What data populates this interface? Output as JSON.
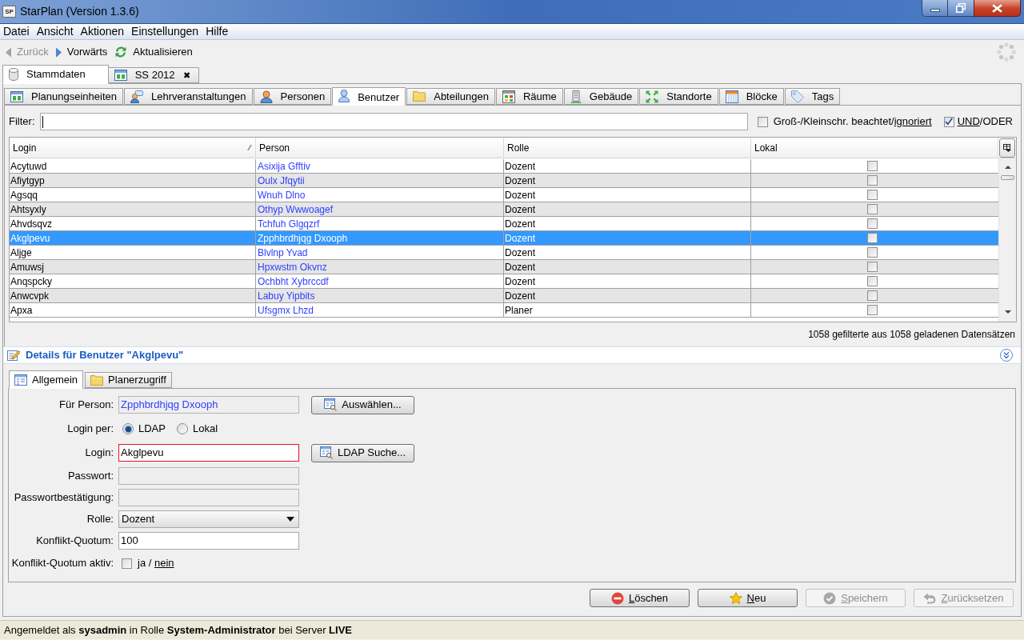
{
  "window": {
    "logo": "SP",
    "title": "StarPlan (Version 1.3.6)"
  },
  "menu": [
    "Datei",
    "Ansicht",
    "Aktionen",
    "Einstellungen",
    "Hilfe"
  ],
  "toolbar": [
    {
      "kind": "back",
      "label": "Zurück",
      "disabled": true
    },
    {
      "kind": "forward",
      "label": "Vorwärts",
      "disabled": false
    },
    {
      "kind": "refresh",
      "label": "Aktualisieren",
      "disabled": false
    }
  ],
  "main_tabs": [
    {
      "kind": "database",
      "label": "Stammdaten",
      "selected": true
    },
    {
      "kind": "table",
      "label": "SS 2012",
      "selected": false,
      "close": "✖"
    }
  ],
  "entity_tabs": [
    {
      "kind": "table",
      "label": "Planungseinheiten",
      "selected": false
    },
    {
      "kind": "lecture",
      "label": "Lehrveranstaltungen",
      "selected": false
    },
    {
      "kind": "persons",
      "label": "Personen",
      "selected": false
    },
    {
      "kind": "user",
      "label": "Benutzer",
      "selected": true
    },
    {
      "kind": "folder",
      "label": "Abteilungen",
      "selected": false
    },
    {
      "kind": "rooms",
      "label": "Räume",
      "selected": false
    },
    {
      "kind": "building",
      "label": "Gebäude",
      "selected": false
    },
    {
      "kind": "locations",
      "label": "Standorte",
      "selected": false
    },
    {
      "kind": "calendar",
      "label": "Blöcke",
      "selected": false
    },
    {
      "kind": "tag",
      "label": "Tags",
      "selected": false
    }
  ],
  "filter": {
    "label": "Filter:"
  },
  "case_option": {
    "text": "Groß-/Kleinschr. ",
    "options": [
      "beachtet",
      "ignoriert"
    ],
    "separator": "/",
    "checked": false
  },
  "logic_option": {
    "options": [
      "UND",
      "ODER"
    ],
    "separator": "/",
    "checked": true
  },
  "table": {
    "columns": [
      {
        "label": "Login",
        "sorted": true
      },
      {
        "label": "Person",
        "sorted": false
      },
      {
        "label": "Rolle",
        "sorted": false
      },
      {
        "label": "Lokal",
        "sorted": false
      }
    ],
    "rows": [
      {
        "login": "Acytuwd",
        "person": "Asixija Gfftiv",
        "role": "Dozent",
        "local": false,
        "selected": false
      },
      {
        "login": "Afiytgyp",
        "person": "Oulx Jfqytii",
        "role": "Dozent",
        "local": false,
        "selected": false
      },
      {
        "login": "Agsqq",
        "person": "Wnuh Dlno",
        "role": "Dozent",
        "local": false,
        "selected": false
      },
      {
        "login": "Ahtsyxly",
        "person": "Othyp Wwwoagef",
        "role": "Dozent",
        "local": false,
        "selected": false
      },
      {
        "login": "Ahvdsqvz",
        "person": "Tchfuh Glgqzrf",
        "role": "Dozent",
        "local": false,
        "selected": false
      },
      {
        "login": "Akglpevu",
        "person": "Zpphbrdhjqg Dxooph",
        "role": "Dozent",
        "local": false,
        "selected": true
      },
      {
        "login": "Aljge",
        "person": "Blvlnp Yvad",
        "role": "Dozent",
        "local": false,
        "selected": false
      },
      {
        "login": "Amuwsj",
        "person": "Hpxwstm Okvnz",
        "role": "Dozent",
        "local": false,
        "selected": false
      },
      {
        "login": "Anqspcky",
        "person": "Ochbht Xybrccdf",
        "role": "Dozent",
        "local": false,
        "selected": false
      },
      {
        "login": "Anwcvpk",
        "person": "Labuy Yipbits",
        "role": "Dozent",
        "local": false,
        "selected": false
      },
      {
        "login": "Apxa",
        "person": "Ufsgmx Lhzd",
        "role": "Planer",
        "local": false,
        "selected": false
      }
    ]
  },
  "record_count": "1058 gefilterte aus 1058 geladenen Datensätzen",
  "details": {
    "title": "Details für Benutzer \"Akglpevu\"",
    "tabs": [
      {
        "kind": "form",
        "label": "Allgemein",
        "selected": true
      },
      {
        "kind": "folder",
        "label": "Planerzugriff",
        "selected": false
      }
    ],
    "fields": [
      {
        "kind": "link",
        "label": "Für Person:",
        "value": "Zpphbrdhjqg Dxooph",
        "disabled": true,
        "invalid": false,
        "button": "Auswählen..."
      },
      {
        "kind": "radio",
        "label": "Login per:",
        "options": [
          {
            "label": "LDAP",
            "selected": true
          },
          {
            "label": "Lokal",
            "selected": false
          }
        ]
      },
      {
        "kind": "text",
        "label": "Login:",
        "value": "Akglpevu",
        "disabled": false,
        "invalid": true,
        "button": "LDAP Suche..."
      },
      {
        "kind": "text",
        "label": "Passwort:",
        "disabled": true,
        "invalid": false
      },
      {
        "kind": "text",
        "label": "Passwortbestätigung:",
        "disabled": true,
        "invalid": false
      },
      {
        "kind": "select",
        "label": "Rolle:",
        "value": "Dozent"
      },
      {
        "kind": "text",
        "label": "Konflikt-Quotum:",
        "value": "100",
        "disabled": false,
        "invalid": false
      },
      {
        "kind": "toggle",
        "label": "Konflikt-Quotum aktiv:",
        "options": [
          "ja",
          "nein"
        ],
        "separator": " / ",
        "checked": false
      }
    ]
  },
  "buttons": [
    {
      "kind": "delete",
      "label": "Löschen",
      "disabled": false
    },
    {
      "kind": "new",
      "label": "Neu",
      "disabled": false
    },
    {
      "kind": "save",
      "label": "Speichern",
      "disabled": true
    },
    {
      "kind": "reset",
      "label": "Zurücksetzen",
      "disabled": true
    }
  ],
  "status_bar": "Angemeldet als **sysadmin** in Rolle **System-Administrator** bei Server **LIVE**"
}
